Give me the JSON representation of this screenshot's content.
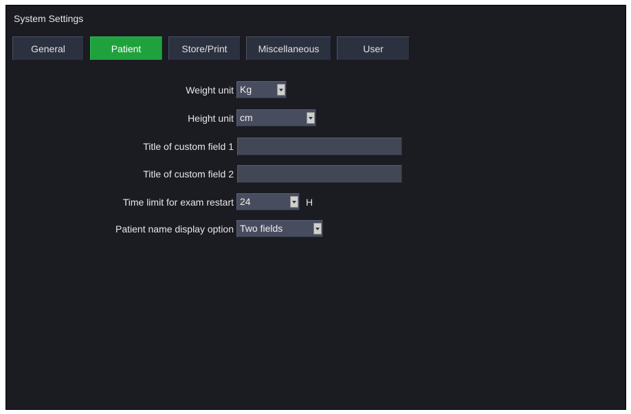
{
  "window": {
    "title": "System Settings"
  },
  "tabs": [
    {
      "label": "General",
      "active": false
    },
    {
      "label": "Patient",
      "active": true
    },
    {
      "label": "Store/Print",
      "active": false
    },
    {
      "label": "Miscellaneous",
      "active": false
    },
    {
      "label": "User",
      "active": false
    }
  ],
  "form": {
    "weight_unit": {
      "label": "Weight unit",
      "value": "Kg"
    },
    "height_unit": {
      "label": "Height unit",
      "value": "cm"
    },
    "custom_field_1": {
      "label": "Title of custom field 1",
      "value": ""
    },
    "custom_field_2": {
      "label": "Title of custom field 2",
      "value": ""
    },
    "exam_restart_limit": {
      "label": "Time limit for exam restart",
      "value": "24",
      "unit": "H"
    },
    "name_display_option": {
      "label": "Patient name display option",
      "value": "Two fields"
    }
  },
  "colors": {
    "background": "#1b1b22",
    "tab_inactive": "#2c3140",
    "tab_active": "#1fa23d",
    "field": "#474d5e"
  },
  "icons": {
    "dropdown": "chevron-down-icon"
  }
}
